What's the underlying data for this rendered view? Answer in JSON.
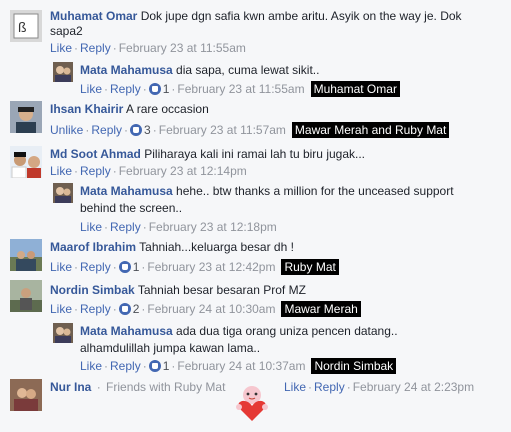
{
  "comments": [
    {
      "name": "Muhamat Omar",
      "text_line1": "Dok jupe dgn safia kwn ambe aritu. Asyik on the way je. Dok",
      "text_line2": "sapa2",
      "like": "Like",
      "reply": "Reply",
      "time": "February 23 at 11:55am"
    },
    {
      "name": "Mata Mahamusa",
      "text": "dia sapa, cuma lewat sikit..",
      "like": "Like",
      "reply": "Reply",
      "likes": "1",
      "time": "February 23 at 11:55am",
      "tag": "Muhamat Omar"
    },
    {
      "name": "Ihsan Khairir",
      "text": "A rare occasion",
      "like": "Unlike",
      "reply": "Reply",
      "likes": "3",
      "time": "February 23 at 11:57am",
      "tag": "Mawar Merah and Ruby Mat"
    },
    {
      "name": "Md Soot Ahmad",
      "text": "Piliharaya kali ini ramai lah tu biru jugak...",
      "like": "Like",
      "reply": "Reply",
      "time": "February 23 at 12:14pm"
    },
    {
      "name": "Mata Mahamusa",
      "text_line1": "hehe.. btw thanks a million for the unceased support",
      "text_line2": "behind the screen..",
      "like": "Like",
      "reply": "Reply",
      "time": "February 23 at 12:18pm"
    },
    {
      "name": "Maarof Ibrahim",
      "text": "Tahniah...keluarga besar dh !",
      "like": "Like",
      "reply": "Reply",
      "likes": "1",
      "time": "February 23 at 12:42pm",
      "tag": "Ruby Mat"
    },
    {
      "name": "Nordin Simbak",
      "text": "Tahniah besar besaran Prof MZ",
      "like": "Like",
      "reply": "Reply",
      "likes": "2",
      "time": "February 24 at 10:30am",
      "tag": "Mawar Merah"
    },
    {
      "name": "Mata Mahamusa",
      "text_line1": "ada dua tiga orang uniza pencen datang..",
      "text_line2": "alhamdulillah jumpa kawan lama..",
      "like": "Like",
      "reply": "Reply",
      "likes": "1",
      "time": "February 24 at 10:37am",
      "tag": "Nordin Simbak"
    },
    {
      "name": "Nur Ina",
      "text": "Friends with Ruby Mat",
      "like": "Like",
      "reply": "Reply",
      "time": "February 24 at 2:23pm"
    }
  ],
  "icons": {
    "like_reaction": "thumbs-up-icon",
    "sticker": "heart-sticker-icon"
  },
  "colors": {
    "link": "#365899",
    "action": "#4267b2",
    "meta": "#90949c",
    "tag_bg": "#000000"
  }
}
